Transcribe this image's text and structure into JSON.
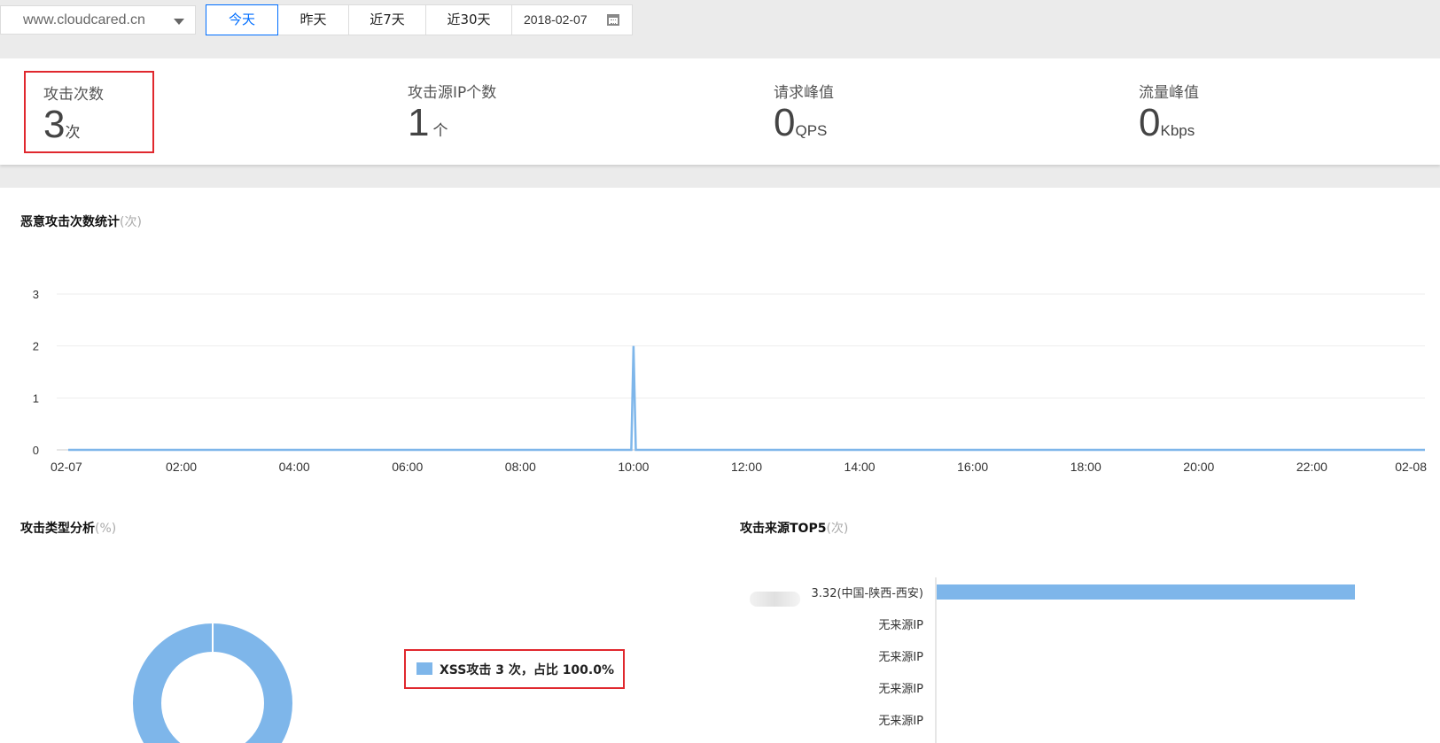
{
  "toolbar": {
    "domain": "www.cloudcared.cn",
    "ranges": [
      "今天",
      "昨天",
      "近7天",
      "近30天"
    ],
    "active_range": "今天",
    "date": "2018-02-07"
  },
  "stats": [
    {
      "label": "攻击次数",
      "value": "3",
      "unit": "次"
    },
    {
      "label": "攻击源IP个数",
      "value": "1",
      "unit": "个"
    },
    {
      "label": "请求峰值",
      "value": "0",
      "unit": "QPS"
    },
    {
      "label": "流量峰值",
      "value": "0",
      "unit": "Kbps"
    }
  ],
  "attack_chart": {
    "title": "恶意攻击次数统计",
    "unit": "(次)"
  },
  "type_chart": {
    "title": "攻击类型分析",
    "unit": "(%)",
    "legend": "XSS攻击 3 次，占比 100.0%"
  },
  "top5_chart": {
    "title": "攻击来源TOP5",
    "unit": "(次)"
  },
  "colors": {
    "accent": "#006eff",
    "series": "#7eb6ea",
    "highlight": "#e0282e"
  },
  "chart_data": [
    {
      "type": "line",
      "title": "恶意攻击次数统计",
      "ylabel": "",
      "xlabel": "",
      "xticks": [
        "02-07",
        "02:00",
        "04:00",
        "06:00",
        "08:00",
        "10:00",
        "12:00",
        "14:00",
        "16:00",
        "18:00",
        "20:00",
        "22:00",
        "02-08"
      ],
      "yticks": [
        0,
        1,
        2,
        3
      ],
      "ylim": [
        0,
        3
      ],
      "xlim_hours": [
        0,
        24
      ],
      "series": [
        {
          "x": [
            0,
            9.96,
            10.0,
            10.04,
            24
          ],
          "y": [
            0,
            0,
            2,
            0,
            0
          ]
        }
      ],
      "grid": true
    },
    {
      "type": "pie",
      "title": "攻击类型分析",
      "labels": [
        "XSS攻击"
      ],
      "values": [
        100.0
      ],
      "counts": [
        3
      ]
    },
    {
      "type": "bar",
      "title": "攻击来源TOP5",
      "categories": [
        "3.32(中国-陕西-西安)",
        "无来源IP",
        "无来源IP",
        "无来源IP",
        "无来源IP"
      ],
      "values": [
        3,
        0,
        0,
        0,
        0
      ],
      "orientation": "horizontal",
      "xlim": [
        0,
        3
      ]
    }
  ]
}
